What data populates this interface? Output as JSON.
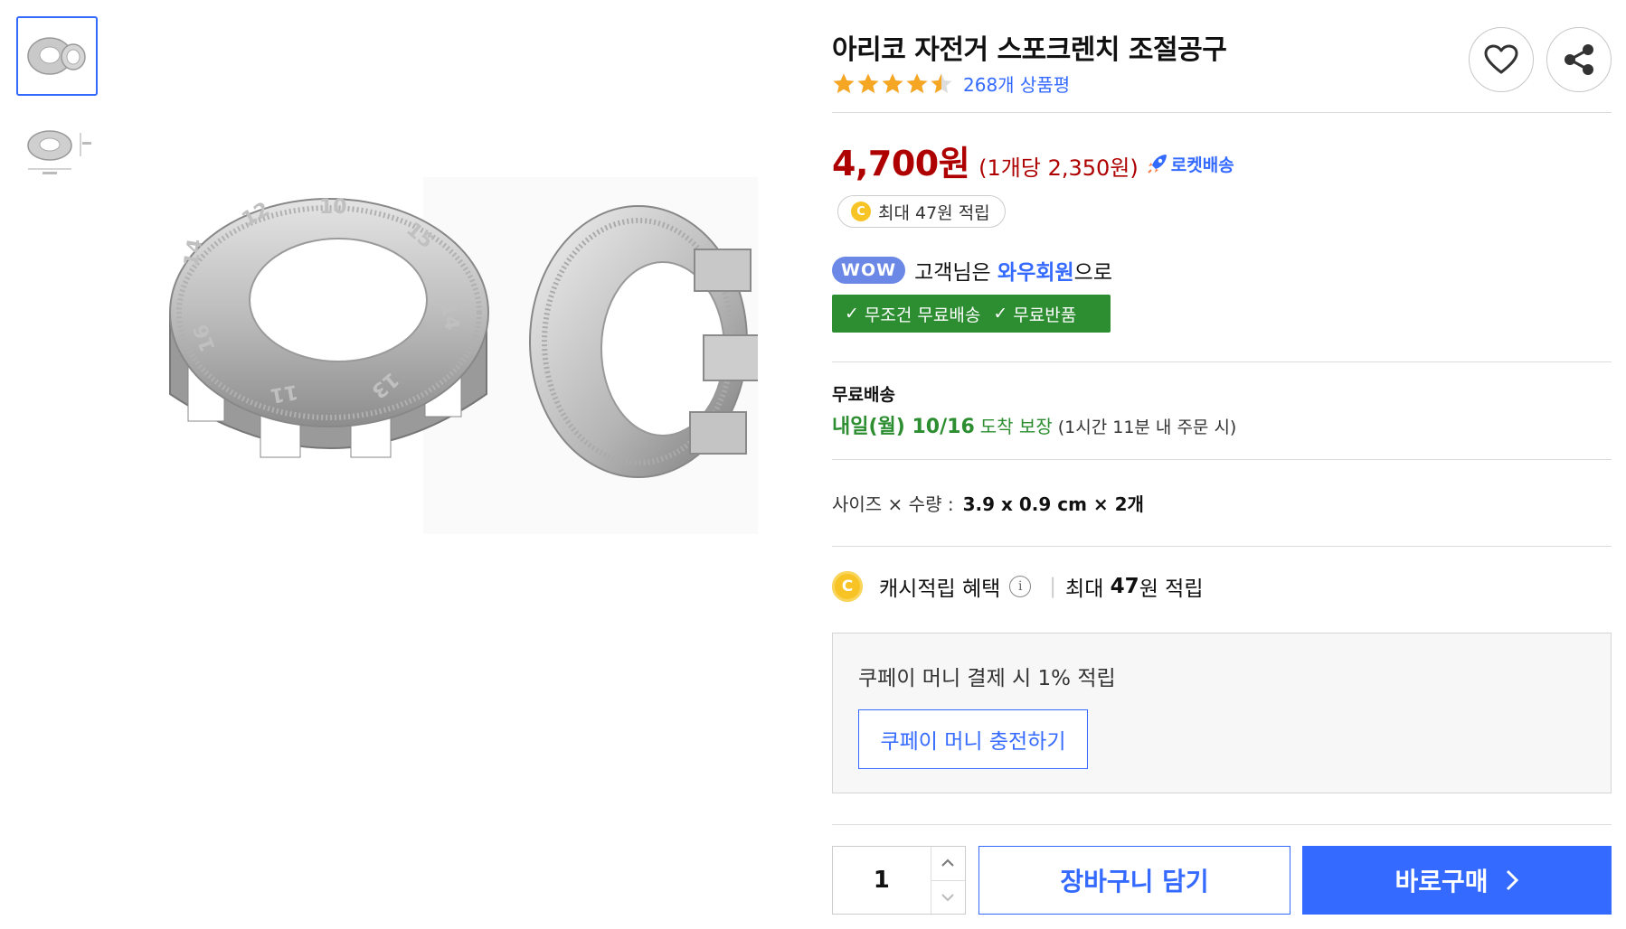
{
  "product": {
    "title": "아리코 자전거 스포크렌치 조절공구",
    "rating": 4.5,
    "review_count": "268개 상품평"
  },
  "price": {
    "main": "4,700원",
    "unit": "(1개당 2,350원)",
    "delivery_badge": "로켓배송"
  },
  "reward": {
    "coin_symbol": "C",
    "text": "최대 47원 적립"
  },
  "wow": {
    "badge": "WOW",
    "prefix": "고객님은 ",
    "member": "와우회원",
    "suffix": "으로",
    "benefits": [
      "무조건 무료배송",
      "무료반품"
    ]
  },
  "shipping": {
    "title": "무료배송",
    "date": "내일(월) 10/16",
    "guarantee": "도착 보장",
    "note": "(1시간 11분 내 주문 시)"
  },
  "size": {
    "label": "사이즈 × 수량 :",
    "value": "3.9 x 0.9 cm × 2개"
  },
  "cash": {
    "coin_symbol": "C",
    "label": "캐시적립 혜택",
    "info_symbol": "i",
    "separator": "|",
    "prefix": "최대 ",
    "amount": "47",
    "suffix": "원 적립"
  },
  "coupay": {
    "text": "쿠페이 머니 결제 시 1% 적립",
    "charge_button": "쿠페이 머니 충전하기"
  },
  "purchase": {
    "quantity": "1",
    "add_to_cart": "장바구니 담기",
    "buy_now": "바로구매"
  },
  "colors": {
    "price_red": "#ae0000",
    "accent_blue": "#346aff",
    "wow_green": "#2c8e31",
    "star_orange": "#f5a623",
    "coin_yellow": "#f7c325"
  }
}
